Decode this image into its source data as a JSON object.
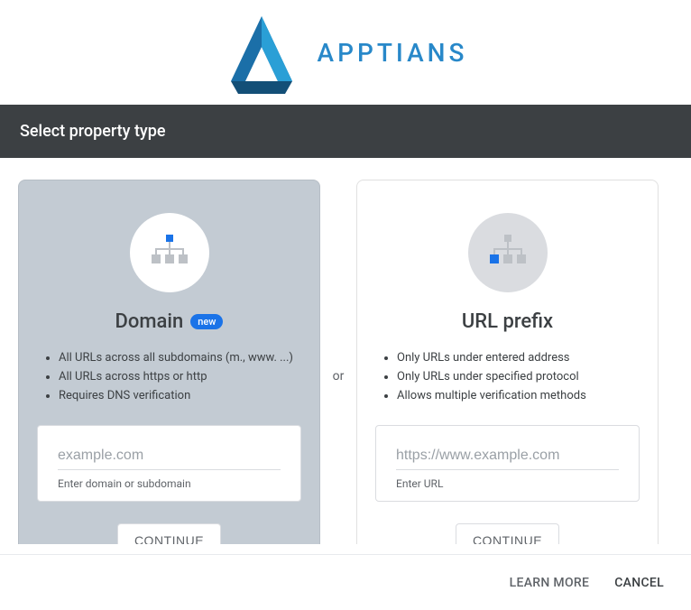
{
  "brand": {
    "name": "APPTIANS"
  },
  "header": {
    "title": "Select property type"
  },
  "separator": "or",
  "card_domain": {
    "title": "Domain",
    "badge": "new",
    "bullets": [
      "All URLs across all subdomains (m., www. ...)",
      "All URLs across https or http",
      "Requires DNS verification"
    ],
    "placeholder": "example.com",
    "helper": "Enter domain or subdomain",
    "button": "CONTINUE"
  },
  "card_urlprefix": {
    "title": "URL prefix",
    "bullets": [
      "Only URLs under entered address",
      "Only URLs under specified protocol",
      "Allows multiple verification methods"
    ],
    "placeholder": "https://www.example.com",
    "helper": "Enter URL",
    "button": "CONTINUE"
  },
  "footer": {
    "learn_more": "LEARN MORE",
    "cancel": "CANCEL"
  }
}
